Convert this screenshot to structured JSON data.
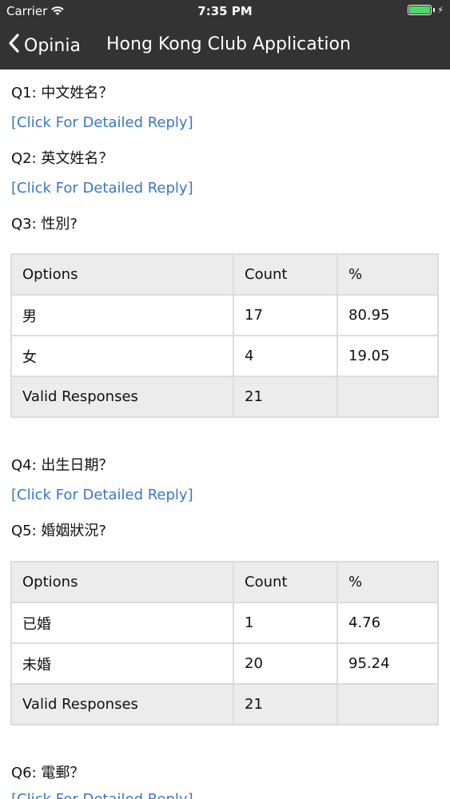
{
  "status_bar": {
    "carrier": "Carrier",
    "time": "7:35 PM",
    "battery_color": "#4cd964"
  },
  "nav": {
    "back_label": "Opinia",
    "title": "Hong Kong Club Application"
  },
  "colors": {
    "bar_background": "#333333",
    "link": "#3a77c6",
    "table_header": "#ececec"
  },
  "link_label": "[Click For Detailed Reply]",
  "questions": [
    {
      "label": "Q1: 中文姓名？"
    },
    {
      "label": "Q2: 英文姓名？"
    },
    {
      "label": "Q3: 性別?",
      "table": {
        "headers": [
          "Options",
          "Count",
          "%"
        ],
        "rows": [
          [
            "男",
            "17",
            "80.95"
          ],
          [
            "女",
            "4",
            "19.05"
          ]
        ],
        "footer": [
          "Valid Responses",
          "21",
          ""
        ]
      }
    },
    {
      "label": "Q4: 出生日期？"
    },
    {
      "label": "Q5: 婚姻狀況?",
      "table": {
        "headers": [
          "Options",
          "Count",
          "%"
        ],
        "rows": [
          [
            "已婚",
            "1",
            "4.76"
          ],
          [
            "未婚",
            "20",
            "95.24"
          ]
        ],
        "footer": [
          "Valid Responses",
          "21",
          ""
        ]
      }
    },
    {
      "label": "Q6: 電郵？"
    }
  ]
}
